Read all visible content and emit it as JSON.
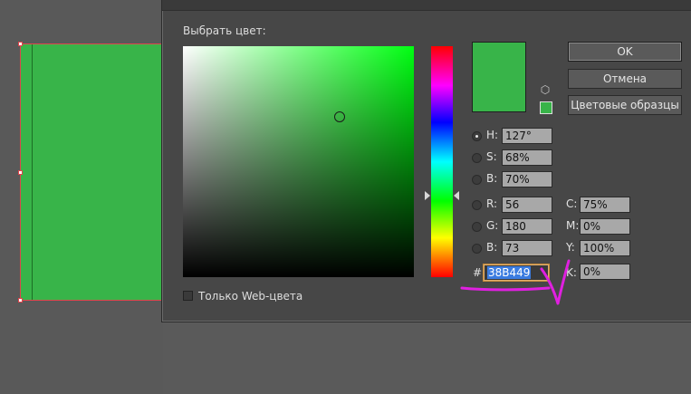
{
  "dialog": {
    "label": "Выбрать цвет:",
    "current_color": "#38b449",
    "buttons": {
      "ok": "OK",
      "cancel": "Отмена",
      "swatches": "Цветовые образцы"
    },
    "hsb": {
      "h_label": "H:",
      "h_value": "127°",
      "s_label": "S:",
      "s_value": "68%",
      "b_label": "B:",
      "b_value": "70%"
    },
    "rgb": {
      "r_label": "R:",
      "r_value": "56",
      "g_label": "G:",
      "g_value": "180",
      "b_label": "B:",
      "b_value": "73"
    },
    "cmyk": {
      "c_label": "C:",
      "c_value": "75%",
      "m_label": "M:",
      "m_value": "0%",
      "y_label": "Y:",
      "y_value": "100%",
      "k_label": "K:",
      "k_value": "0%"
    },
    "hex_label": "#",
    "hex_value": "38B449",
    "web_only_label": "Только Web-цвета",
    "icons": {
      "cube": "cube-icon"
    }
  },
  "annotation": {
    "color": "#e020e0"
  },
  "colors": {
    "object_fill": "#38b449",
    "selection_border": "#e0454d"
  }
}
